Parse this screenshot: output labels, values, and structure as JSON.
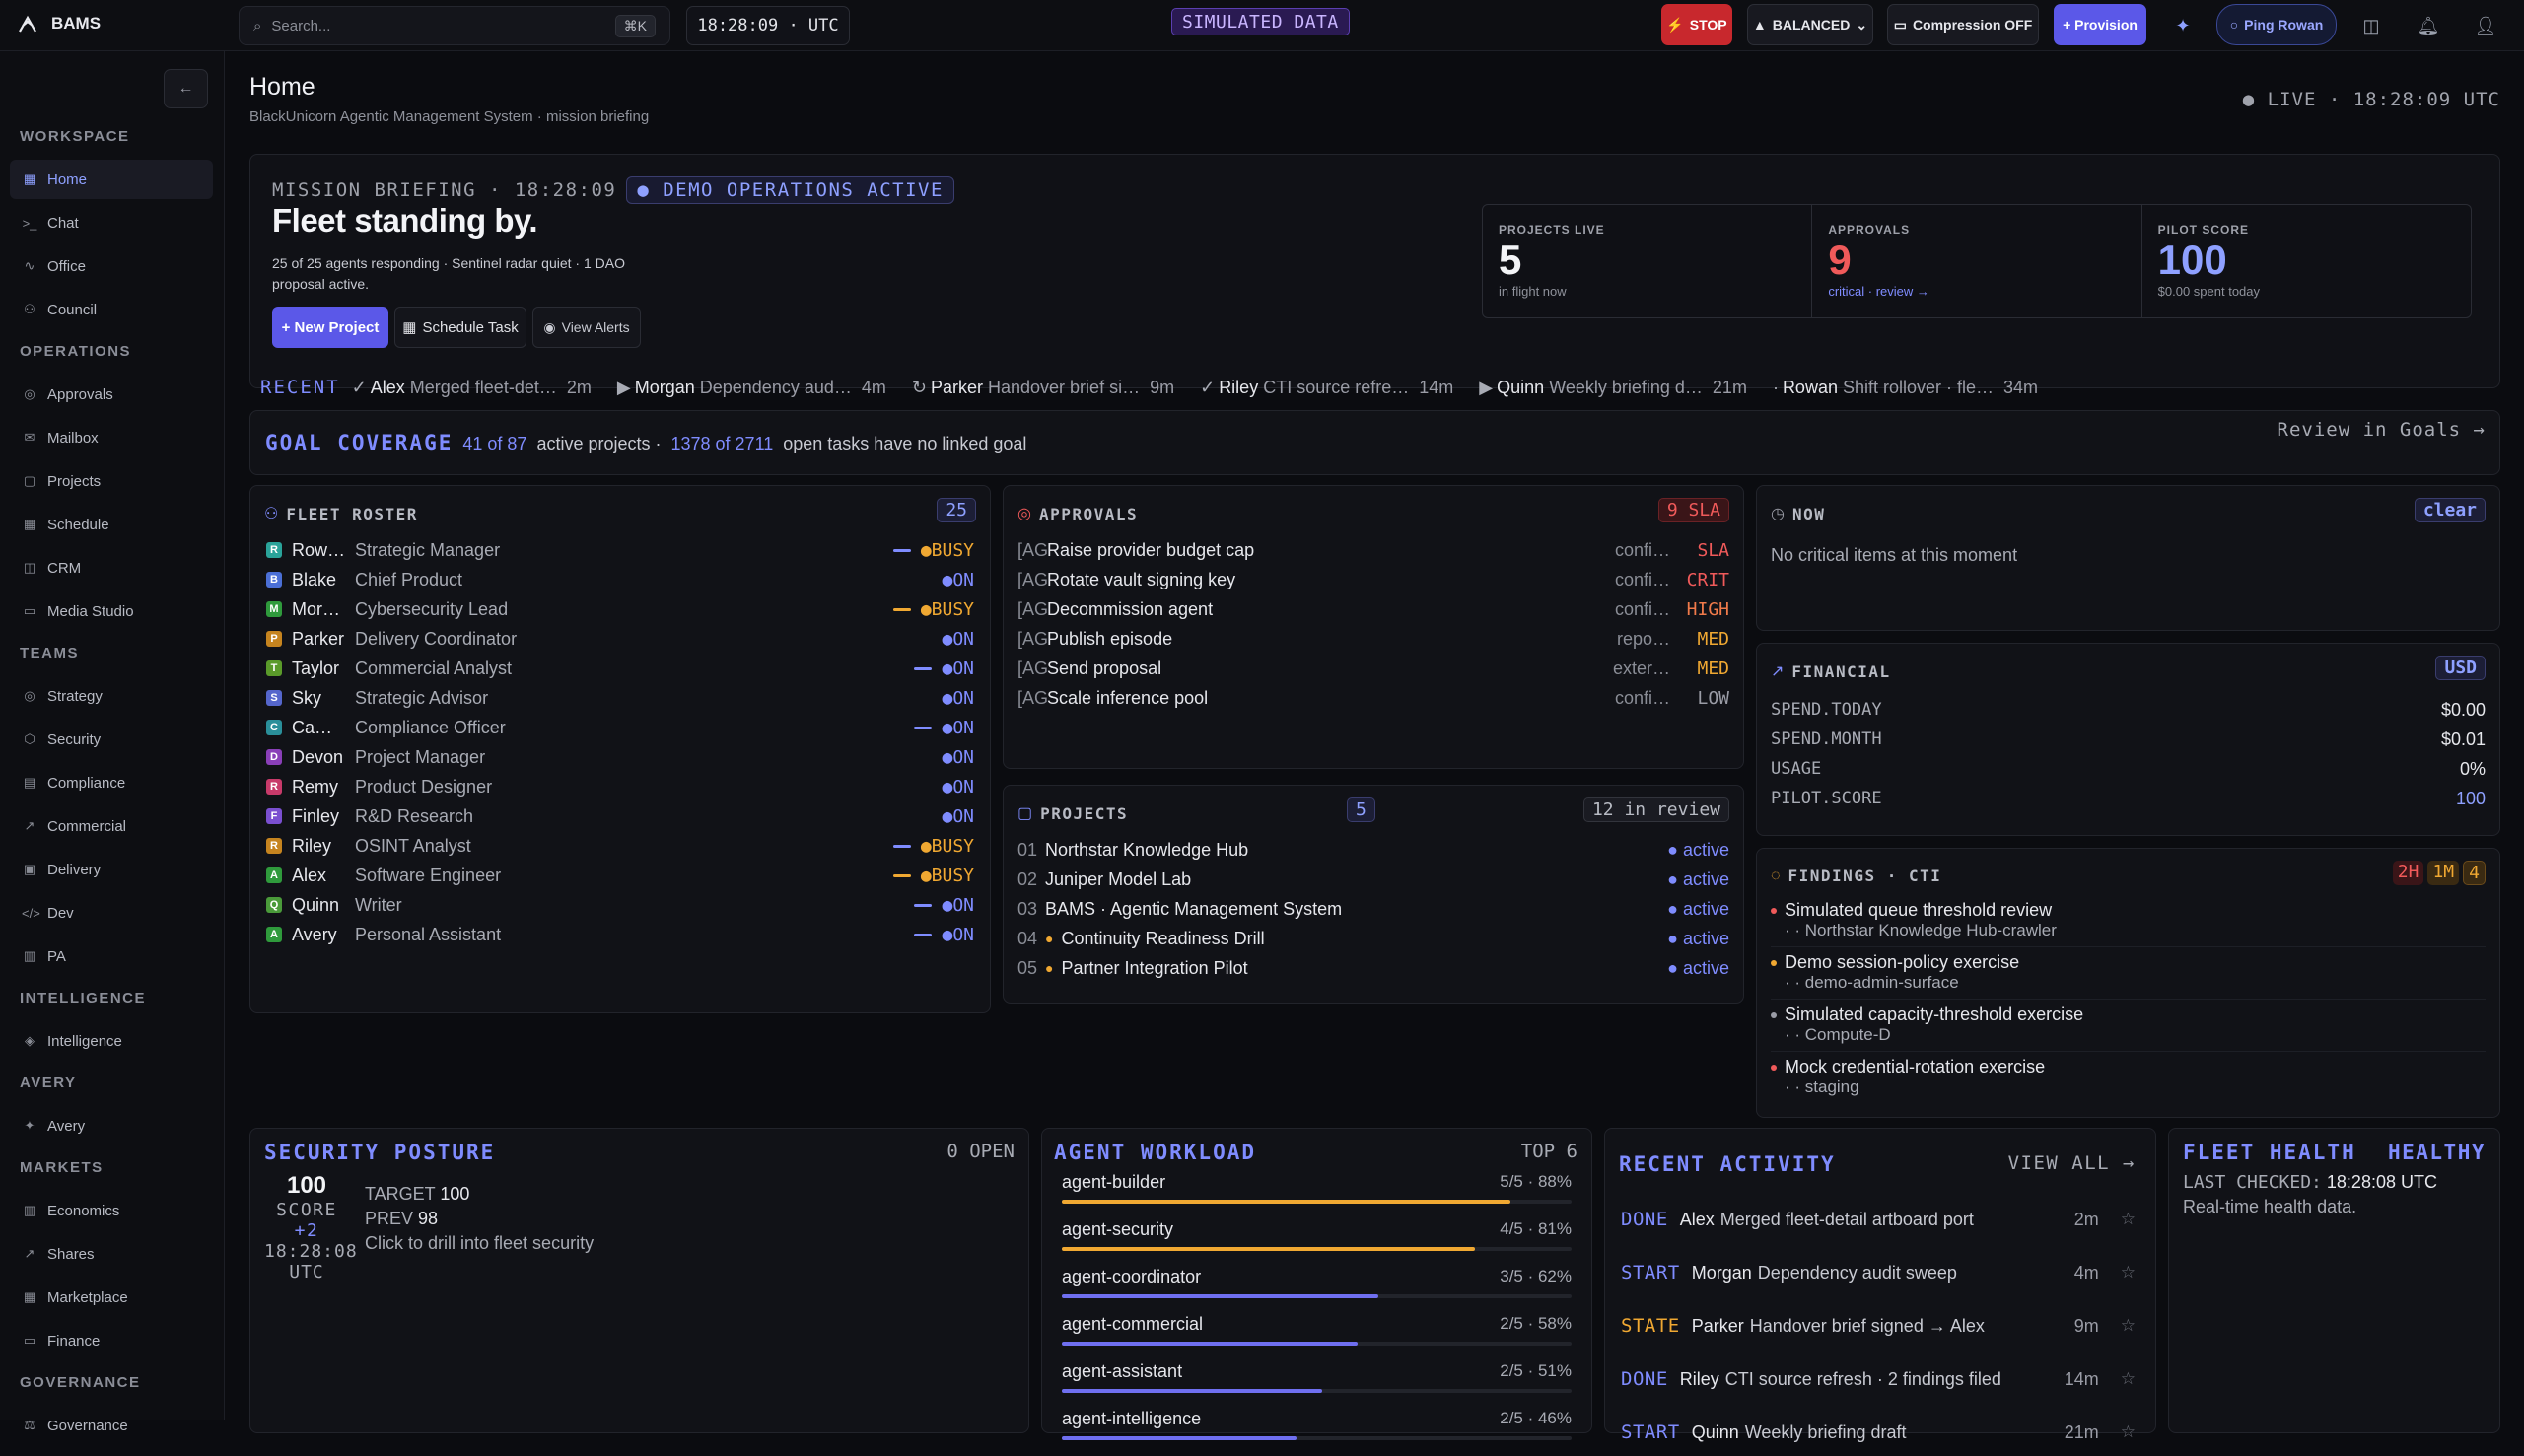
{
  "app": {
    "name": "BAMS"
  },
  "search": {
    "placeholder": "Search...",
    "shortcut": "⌘K"
  },
  "clock": "18:28:09 · UTC",
  "sim_badge": "SIMULATED DATA",
  "topbar": {
    "stop": "STOP",
    "mode": "BALANCED",
    "compression": "Compression OFF",
    "provision": "+ Provision",
    "ping": "Ping Rowan"
  },
  "sidebar": {
    "sections": [
      {
        "title": "WORKSPACE",
        "items": [
          {
            "label": "Home",
            "icon": "grid-icon",
            "active": true
          },
          {
            "label": "Chat",
            "icon": "terminal-icon"
          },
          {
            "label": "Office",
            "icon": "pulse-icon"
          },
          {
            "label": "Council",
            "icon": "users-icon"
          }
        ]
      },
      {
        "title": "OPERATIONS",
        "items": [
          {
            "label": "Approvals",
            "icon": "check-circle-icon"
          },
          {
            "label": "Mailbox",
            "icon": "mail-icon"
          },
          {
            "label": "Projects",
            "icon": "folder-icon"
          },
          {
            "label": "Schedule",
            "icon": "calendar-icon"
          },
          {
            "label": "CRM",
            "icon": "database-icon"
          },
          {
            "label": "Media Studio",
            "icon": "video-icon"
          }
        ]
      },
      {
        "title": "TEAMS",
        "items": [
          {
            "label": "Strategy",
            "icon": "target-icon"
          },
          {
            "label": "Security",
            "icon": "shield-icon"
          },
          {
            "label": "Compliance",
            "icon": "document-icon"
          },
          {
            "label": "Commercial",
            "icon": "trend-icon"
          },
          {
            "label": "Delivery",
            "icon": "package-icon"
          },
          {
            "label": "Dev",
            "icon": "code-icon"
          },
          {
            "label": "PA",
            "icon": "clipboard-icon"
          }
        ]
      },
      {
        "title": "INTELLIGENCE",
        "items": [
          {
            "label": "Intelligence",
            "icon": "compass-icon"
          }
        ]
      },
      {
        "title": "AVERY",
        "items": [
          {
            "label": "Avery",
            "icon": "sparkle-icon"
          }
        ]
      },
      {
        "title": "MARKETS",
        "items": [
          {
            "label": "Economics",
            "icon": "bar-chart-icon"
          },
          {
            "label": "Shares",
            "icon": "trend-icon"
          },
          {
            "label": "Marketplace",
            "icon": "store-icon"
          },
          {
            "label": "Finance",
            "icon": "wallet-icon"
          }
        ]
      },
      {
        "title": "GOVERNANCE",
        "items": [
          {
            "label": "Governance",
            "icon": "gavel-icon"
          }
        ]
      }
    ]
  },
  "page": {
    "title": "Home",
    "subtitle": "BlackUnicorn Agentic Management System · mission briefing",
    "live": "● LIVE · 18:28:09 UTC"
  },
  "briefing": {
    "label": "MISSION BRIEFING · 18:28:09",
    "badge": "● DEMO OPERATIONS ACTIVE",
    "title": "Fleet standing by.",
    "desc1": "25 of 25 agents responding · Sentinel radar quiet · 1 DAO",
    "desc2": "proposal active.",
    "new_project": "+ New Project",
    "schedule": "Schedule Task",
    "alerts": "View Alerts",
    "metrics": [
      {
        "label": "PROJECTS LIVE",
        "value": "5",
        "sub": "in flight now",
        "color": "#f3f4f7"
      },
      {
        "label": "APPROVALS",
        "value": "9",
        "sub": "critical · review →",
        "color": "#f05a5a"
      },
      {
        "label": "PILOT SCORE",
        "value": "100",
        "sub": "$0.00 spent today",
        "color": "#8ea0ff"
      }
    ]
  },
  "recent": {
    "label": "RECENT",
    "items": [
      {
        "icon": "✓",
        "who": "Alex",
        "what": "Merged fleet-det…",
        "t": "2m"
      },
      {
        "icon": "▶",
        "who": "Morgan",
        "what": "Dependency aud…",
        "t": "4m"
      },
      {
        "icon": "↻",
        "who": "Parker",
        "what": "Handover brief si…",
        "t": "9m"
      },
      {
        "icon": "✓",
        "who": "Riley",
        "what": "CTI source refre…",
        "t": "14m"
      },
      {
        "icon": "▶",
        "who": "Quinn",
        "what": "Weekly briefing d…",
        "t": "21m"
      },
      {
        "icon": "·",
        "who": "Rowan",
        "what": "Shift rollover · fle…",
        "t": "34m"
      }
    ]
  },
  "goal": {
    "label": "GOAL COVERAGE",
    "a": "41 of 87",
    "b": "active projects ·",
    "c": "1378 of 2711",
    "d": "open tasks have no linked goal",
    "link": "Review in Goals →"
  },
  "roster": {
    "title": "FLEET ROSTER",
    "count": "25",
    "agents": [
      {
        "i": "R",
        "name": "Row…",
        "role": "Strategic Manager",
        "status": "●BUSY",
        "busy": true,
        "color": "#2aa39a",
        "bar": "#7f8cff"
      },
      {
        "i": "B",
        "name": "Blake",
        "role": "Chief Product",
        "status": "●ON",
        "busy": false,
        "color": "#4b6fd6",
        "bar": ""
      },
      {
        "i": "M",
        "name": "Mor…",
        "role": "Cybersecurity Lead",
        "status": "●BUSY",
        "busy": true,
        "color": "#2f9a3c",
        "bar": "#f0a832"
      },
      {
        "i": "P",
        "name": "Parker",
        "role": "Delivery Coordinator",
        "status": "●ON",
        "busy": false,
        "color": "#c6841f",
        "bar": ""
      },
      {
        "i": "T",
        "name": "Taylor",
        "role": "Commercial Analyst",
        "status": "●ON",
        "busy": false,
        "color": "#5a9a2a",
        "bar": "#7f8cff"
      },
      {
        "i": "S",
        "name": "Sky",
        "role": "Strategic Advisor",
        "status": "●ON",
        "busy": false,
        "color": "#5566cc",
        "bar": ""
      },
      {
        "i": "C",
        "name": "Ca…",
        "role": "Compliance Officer",
        "status": "●ON",
        "busy": false,
        "color": "#2a8f9a",
        "bar": "#7f8cff"
      },
      {
        "i": "D",
        "name": "Devon",
        "role": "Project Manager",
        "status": "●ON",
        "busy": false,
        "color": "#8a3fb8",
        "bar": ""
      },
      {
        "i": "R",
        "name": "Remy",
        "role": "Product Designer",
        "status": "●ON",
        "busy": false,
        "color": "#c83a6a",
        "bar": ""
      },
      {
        "i": "F",
        "name": "Finley",
        "role": "R&D Research",
        "status": "●ON",
        "busy": false,
        "color": "#7a4fd0",
        "bar": ""
      },
      {
        "i": "R",
        "name": "Riley",
        "role": "OSINT Analyst",
        "status": "●BUSY",
        "busy": true,
        "color": "#c6841f",
        "bar": "#7f8cff"
      },
      {
        "i": "A",
        "name": "Alex",
        "role": "Software Engineer",
        "status": "●BUSY",
        "busy": true,
        "color": "#2f9a3c",
        "bar": "#f0a832"
      },
      {
        "i": "Q",
        "name": "Quinn",
        "role": "Writer",
        "status": "●ON",
        "busy": false,
        "color": "#4a9a3a",
        "bar": "#7f8cff"
      },
      {
        "i": "A",
        "name": "Avery",
        "role": "Personal Assistant",
        "status": "●ON",
        "busy": false,
        "color": "#2f9a3c",
        "bar": "#7f8cff"
      }
    ]
  },
  "approvals": {
    "title": "APPROVALS",
    "badge": "9 SLA",
    "items": [
      {
        "tag": "[AG",
        "text": "Raise provider budget cap",
        "src": "confi…",
        "level": "SLA",
        "color": "#f05a5a"
      },
      {
        "tag": "[AG",
        "text": "Rotate vault signing key",
        "src": "confi…",
        "level": "CRIT",
        "color": "#f05a5a"
      },
      {
        "tag": "[AG",
        "text": "Decommission agent",
        "src": "confi…",
        "level": "HIGH",
        "color": "#f07a4a"
      },
      {
        "tag": "[AG",
        "text": "Publish episode",
        "src": "repo…",
        "level": "MED",
        "color": "#f0a832"
      },
      {
        "tag": "[AG",
        "text": "Send proposal",
        "src": "exter…",
        "level": "MED",
        "color": "#f0a832"
      },
      {
        "tag": "[AG",
        "text": "Scale inference pool",
        "src": "confi…",
        "level": "LOW",
        "color": "#9a9ca6"
      }
    ]
  },
  "projects": {
    "title": "PROJECTS",
    "count": "5",
    "review": "12 in review",
    "items": [
      {
        "n": "01",
        "name": "Northstar Knowledge Hub",
        "dot": "",
        "status": "● active"
      },
      {
        "n": "02",
        "name": "Juniper Model Lab",
        "dot": "",
        "status": "● active"
      },
      {
        "n": "03",
        "name": "BAMS · Agentic Management System",
        "dot": "",
        "status": "● active"
      },
      {
        "n": "04",
        "name": "Continuity Readiness Drill",
        "dot": "●",
        "status": "● active"
      },
      {
        "n": "05",
        "name": "Partner Integration Pilot",
        "dot": "●",
        "status": "● active"
      }
    ]
  },
  "now": {
    "title": "NOW",
    "clear": "clear",
    "text": "No critical items at this moment"
  },
  "financial": {
    "title": "FINANCIAL",
    "currency": "USD",
    "rows": [
      {
        "k": "SPEND.TODAY",
        "v": "$0.00",
        "color": "#e6e7ec"
      },
      {
        "k": "SPEND.MONTH",
        "v": "$0.01",
        "color": "#e6e7ec"
      },
      {
        "k": "USAGE",
        "v": "0%",
        "color": "#e6e7ec"
      },
      {
        "k": "PILOT.SCORE",
        "v": "100",
        "color": "#8ea0ff"
      }
    ]
  },
  "findings": {
    "title": "FINDINGS · CTI",
    "b1": "2H",
    "b2": "1M",
    "b3": "4",
    "items": [
      {
        "title": "Simulated queue threshold review",
        "sub": "· · Northstar Knowledge Hub-crawler",
        "color": "#f05a5a"
      },
      {
        "title": "Demo session-policy exercise",
        "sub": "· · demo-admin-surface",
        "color": "#f0a832"
      },
      {
        "title": "Simulated capacity-threshold exercise",
        "sub": "· · Compute-D",
        "color": "#9a9ca6"
      },
      {
        "title": "Mock credential-rotation exercise",
        "sub": "· · staging",
        "color": "#f05a5a"
      }
    ]
  },
  "security": {
    "title": "SECURITY POSTURE",
    "open": "0 OPEN",
    "score": "100",
    "score_label": "SCORE",
    "delta": "+2",
    "time": "18:28:08",
    "tz": "UTC",
    "target_k": "TARGET",
    "target_v": "100",
    "prev_k": "PREV",
    "prev_v": "98",
    "drill": "Click to drill into fleet security"
  },
  "workload": {
    "title": "AGENT WORKLOAD",
    "top": "TOP 6",
    "items": [
      {
        "name": "agent-builder",
        "val": "5/5 · 88%",
        "pct": 88,
        "color": "#f0a832"
      },
      {
        "name": "agent-security",
        "val": "4/5 · 81%",
        "pct": 81,
        "color": "#f0a832"
      },
      {
        "name": "agent-coordinator",
        "val": "3/5 · 62%",
        "pct": 62,
        "color": "#6f6ff0"
      },
      {
        "name": "agent-commercial",
        "val": "2/5 · 58%",
        "pct": 58,
        "color": "#6f6ff0"
      },
      {
        "name": "agent-assistant",
        "val": "2/5 · 51%",
        "pct": 51,
        "color": "#6f6ff0"
      },
      {
        "name": "agent-intelligence",
        "val": "2/5 · 46%",
        "pct": 46,
        "color": "#6f6ff0"
      }
    ]
  },
  "activity": {
    "title": "RECENT ACTIVITY",
    "view_all": "VIEW ALL →",
    "items": [
      {
        "kind": "DONE",
        "who": "Alex",
        "what": "Merged fleet-detail artboard port",
        "t": "2m",
        "color": "#7f8cff"
      },
      {
        "kind": "START",
        "who": "Morgan",
        "what": "Dependency audit sweep",
        "t": "4m",
        "color": "#7f8cff"
      },
      {
        "kind": "STATE",
        "who": "Parker",
        "what": "Handover brief signed → Alex",
        "t": "9m",
        "color": "#f0a832"
      },
      {
        "kind": "DONE",
        "who": "Riley",
        "what": "CTI source refresh · 2 findings filed",
        "t": "14m",
        "color": "#7f8cff"
      },
      {
        "kind": "START",
        "who": "Quinn",
        "what": "Weekly briefing draft",
        "t": "21m",
        "color": "#7f8cff"
      }
    ]
  },
  "health": {
    "title": "FLEET HEALTH",
    "status": "HEALTHY",
    "checked_k": "LAST CHECKED:",
    "checked_v": "18:28:08 UTC",
    "desc": "Real-time health data."
  }
}
